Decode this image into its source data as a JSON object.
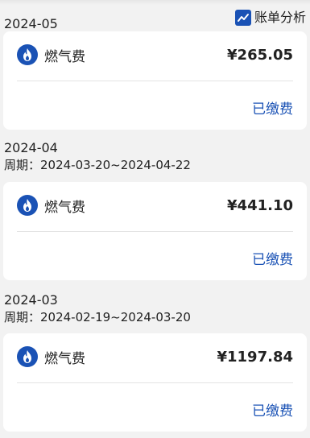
{
  "header": {
    "analysis_label": "账单分析",
    "analysis_icon": "trend-chart-icon"
  },
  "colors": {
    "accent": "#1a52b5",
    "background": "#f2f2f2",
    "card": "#ffffff"
  },
  "bills": [
    {
      "month": "2024-05",
      "period": "",
      "fee_icon": "gas-flame-icon",
      "fee_name": "燃气费",
      "amount": "¥265.05",
      "status": "已缴费"
    },
    {
      "month": "2024-04",
      "period": "周期：2024-03-20~2024-04-22",
      "fee_icon": "gas-flame-icon",
      "fee_name": "燃气费",
      "amount": "¥441.10",
      "status": "已缴费"
    },
    {
      "month": "2024-03",
      "period": "周期：2024-02-19~2024-03-20",
      "fee_icon": "gas-flame-icon",
      "fee_name": "燃气费",
      "amount": "¥1197.84",
      "status": "已缴费"
    }
  ]
}
